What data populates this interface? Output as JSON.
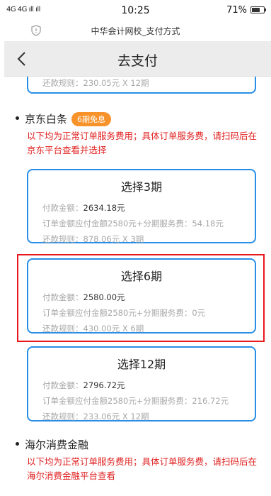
{
  "status_bar": {
    "signal": "4G 4G ıll ıll",
    "time": "10:25",
    "battery": "71%"
  },
  "url_bar": {
    "title": "中华会计网校_支付方式"
  },
  "nav": {
    "title": "去支付"
  },
  "previous_card": {
    "rule_label": "还款规则：",
    "rule_value": "230.05元 X 12期"
  },
  "jd_section": {
    "title": "京东白条",
    "badge": "6期免息",
    "notice": "以下均为正常订单服务费用；具体订单服务费，请扫码后在京东平台查看并选择",
    "options": [
      {
        "title": "选择3期",
        "pay_label": "付款金额：",
        "pay_value": "2634.18元",
        "fee_label": "订单金额应付金额2580元+分期服务费：",
        "fee_value": "54.18元",
        "rule_label": "还款规则：",
        "rule_value": "878.06元 X 3期"
      },
      {
        "title": "选择6期",
        "pay_label": "付款金额：",
        "pay_value": "2580.00元",
        "fee_label": "订单金额应付金额2580元+分期服务费：",
        "fee_value": "0元",
        "rule_label": "还款规则：",
        "rule_value": "430.00元 X 6期"
      },
      {
        "title": "选择12期",
        "pay_label": "付款金额：",
        "pay_value": "2796.72元",
        "fee_label": "订单金额应付金额2580元+分期服务费：",
        "fee_value": "216.72元",
        "rule_label": "还款规则：",
        "rule_value": "233.06元 X 12期"
      }
    ]
  },
  "haier_section": {
    "title": "海尔消费金融",
    "notice": "以下均为正常订单服务费用；具体订单服务费，请扫码后在海尔消费金融平台查看"
  },
  "colors": {
    "card_border": "#2a8ee6",
    "highlight_border": "#e8191e",
    "notice_text": "#e02020",
    "badge_bg": "#f7932a"
  }
}
